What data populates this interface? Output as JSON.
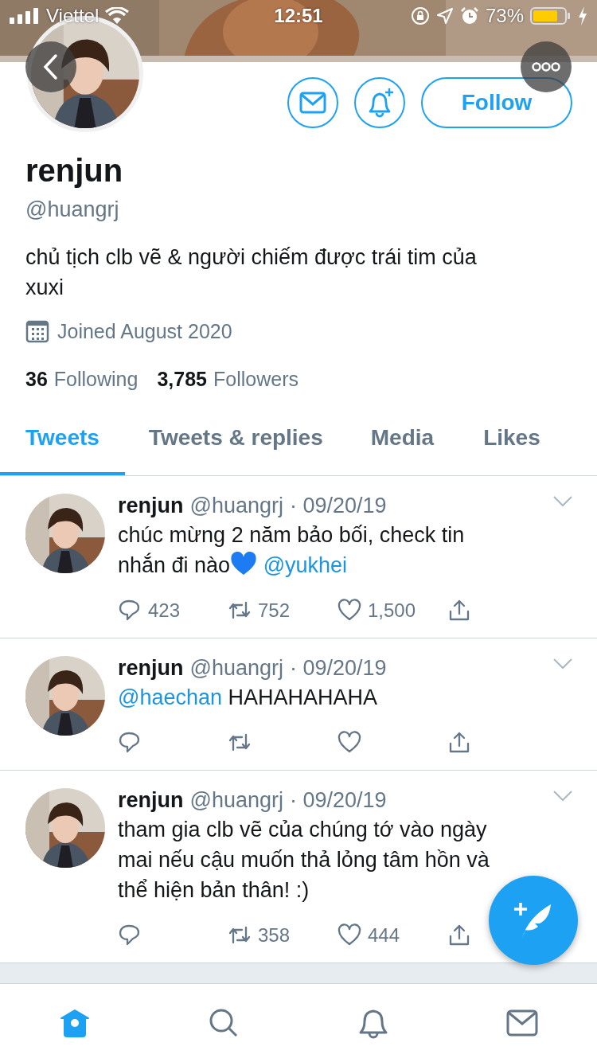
{
  "status_bar": {
    "carrier": "Viettel",
    "time": "12:51",
    "battery": "73%"
  },
  "profile": {
    "name": "renjun",
    "handle": "@huangrj",
    "bio": "chủ tịch clb vẽ & người chiếm được trái tim của xuxi",
    "joined": "Joined August 2020",
    "following_count": "36",
    "following_label": "Following",
    "followers_count": "3,785",
    "followers_label": "Followers",
    "follow_button": "Follow"
  },
  "tabs": [
    {
      "label": "Tweets",
      "selected": true
    },
    {
      "label": "Tweets & replies",
      "selected": false
    },
    {
      "label": "Media",
      "selected": false
    },
    {
      "label": "Likes",
      "selected": false
    }
  ],
  "tweets": [
    {
      "name": "renjun",
      "handle": "@huangrj",
      "date": "· 09/20/19",
      "text": [
        {
          "kind": "text",
          "text": "chúc mừng 2 năm bảo bối, check tin nhắn đi nào"
        },
        {
          "kind": "heart"
        },
        {
          "kind": "mention",
          "text": "@yukhei"
        }
      ],
      "replies": "423",
      "retweets": "752",
      "likes": "1,500"
    },
    {
      "name": "renjun",
      "handle": "@huangrj",
      "date": "· 09/20/19",
      "text": [
        {
          "kind": "mention",
          "text": "@haechan"
        },
        {
          "kind": "text",
          "text": " HAHAHAHAHA"
        }
      ]
    },
    {
      "name": "renjun",
      "handle": "@huangrj",
      "date": "· 09/20/19",
      "text": [
        {
          "kind": "text",
          "text": "tham gia clb vẽ của chúng tớ vào ngày mai nếu cậu muốn thả lỏng tâm hồn và thể hiện bản thân! :)"
        }
      ],
      "retweets": "358",
      "likes": "444"
    }
  ],
  "tab_bar": [
    {
      "kind": "home",
      "selected": true
    },
    {
      "kind": "search",
      "selected": false
    },
    {
      "kind": "notifications",
      "selected": false
    },
    {
      "kind": "messages",
      "selected": false
    }
  ]
}
